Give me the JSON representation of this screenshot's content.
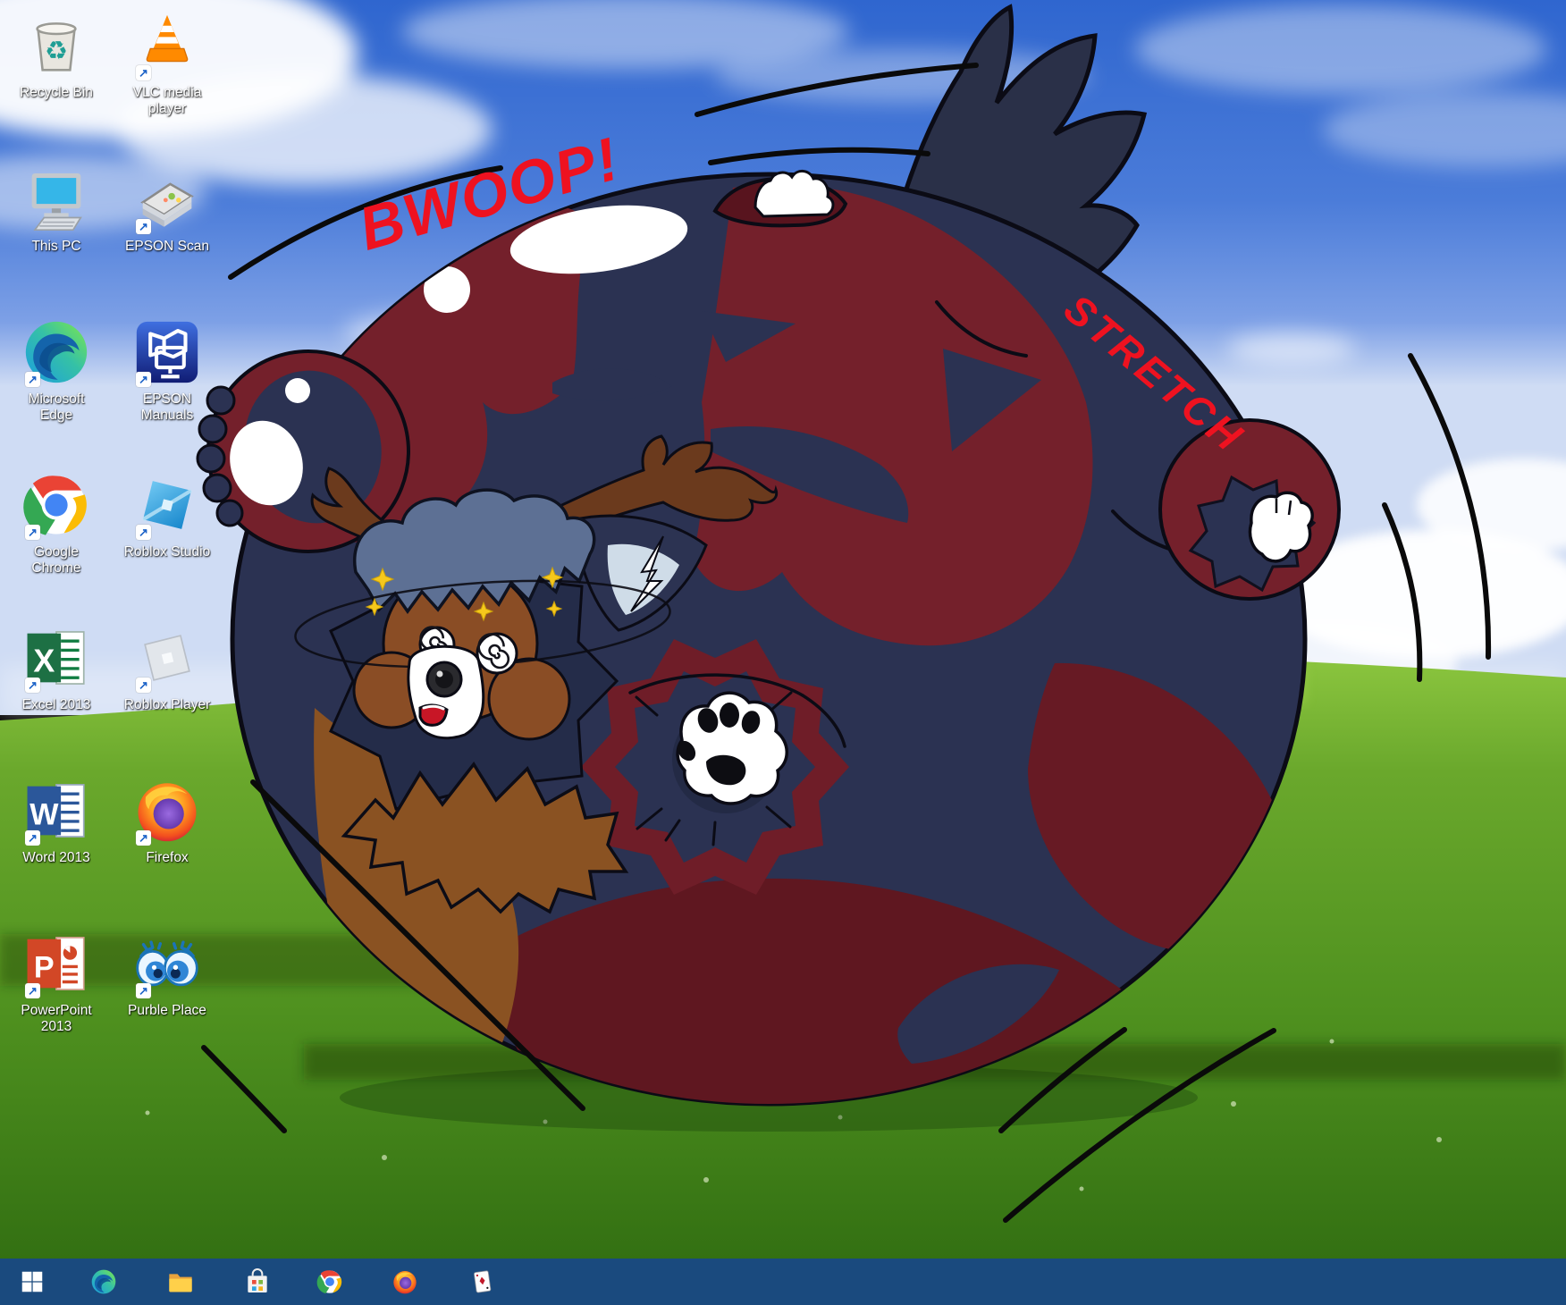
{
  "desktop": {
    "icons": [
      {
        "id": "recycle-bin",
        "label": "Recycle Bin",
        "type": "recycle-bin",
        "shortcut": false,
        "col": 0,
        "row": 0
      },
      {
        "id": "vlc-media-player",
        "label": "VLC media player",
        "type": "vlc",
        "shortcut": true,
        "col": 1,
        "row": 0
      },
      {
        "id": "this-pc",
        "label": "This PC",
        "type": "this-pc",
        "shortcut": false,
        "col": 0,
        "row": 1
      },
      {
        "id": "epson-scan",
        "label": "EPSON Scan",
        "type": "epson-scan",
        "shortcut": true,
        "col": 1,
        "row": 1
      },
      {
        "id": "microsoft-edge",
        "label": "Microsoft Edge",
        "type": "edge",
        "shortcut": true,
        "col": 0,
        "row": 2
      },
      {
        "id": "epson-manuals",
        "label": "EPSON Manuals",
        "type": "epson-manuals",
        "shortcut": true,
        "col": 1,
        "row": 2
      },
      {
        "id": "google-chrome",
        "label": "Google Chrome",
        "type": "chrome",
        "shortcut": true,
        "col": 0,
        "row": 3
      },
      {
        "id": "roblox-studio",
        "label": "Roblox Studio",
        "type": "roblox-studio",
        "shortcut": true,
        "col": 1,
        "row": 3
      },
      {
        "id": "excel-2013",
        "label": "Excel 2013",
        "type": "excel",
        "shortcut": true,
        "col": 0,
        "row": 4
      },
      {
        "id": "roblox-player",
        "label": "Roblox Player",
        "type": "roblox-player",
        "shortcut": true,
        "col": 1,
        "row": 4
      },
      {
        "id": "word-2013",
        "label": "Word 2013",
        "type": "word",
        "shortcut": true,
        "col": 0,
        "row": 5
      },
      {
        "id": "firefox",
        "label": "Firefox",
        "type": "firefox",
        "shortcut": true,
        "col": 1,
        "row": 5
      },
      {
        "id": "powerpoint-2013",
        "label": "PowerPoint 2013",
        "type": "powerpoint",
        "shortcut": true,
        "col": 0,
        "row": 6
      },
      {
        "id": "purble-place",
        "label": "Purble Place",
        "type": "purble-place",
        "shortcut": true,
        "col": 1,
        "row": 6
      }
    ]
  },
  "taskbar": {
    "items": [
      {
        "id": "start",
        "name": "start-button",
        "type": "start"
      },
      {
        "id": "edge",
        "name": "taskbar-edge-icon",
        "type": "edge"
      },
      {
        "id": "file-explorer",
        "name": "taskbar-file-explorer-icon",
        "type": "folder"
      },
      {
        "id": "microsoft-store",
        "name": "taskbar-store-icon",
        "type": "store"
      },
      {
        "id": "chrome",
        "name": "taskbar-chrome-icon",
        "type": "chrome"
      },
      {
        "id": "firefox",
        "name": "taskbar-firefox-icon",
        "type": "firefox"
      },
      {
        "id": "solitaire",
        "name": "taskbar-solitaire-icon",
        "type": "solitaire"
      }
    ]
  },
  "artwork": {
    "sfx_bwoop": "BWOOP!",
    "sfx_stretch": "STRETCH"
  },
  "colors": {
    "taskbar": "#1a4a7e",
    "sfx_red": "#ee1220",
    "sky_top": "#2f66cf",
    "sky_horizon": "#cfdcf4",
    "grass_light": "#7ab437",
    "grass_dark": "#2e6a10",
    "balloon_navy": "#2b3252",
    "balloon_maroon": "#74202b",
    "balloon_maroon_dark": "#5f1720",
    "tail_navy": "#2a3048",
    "fur_brown": "#8a5222"
  }
}
